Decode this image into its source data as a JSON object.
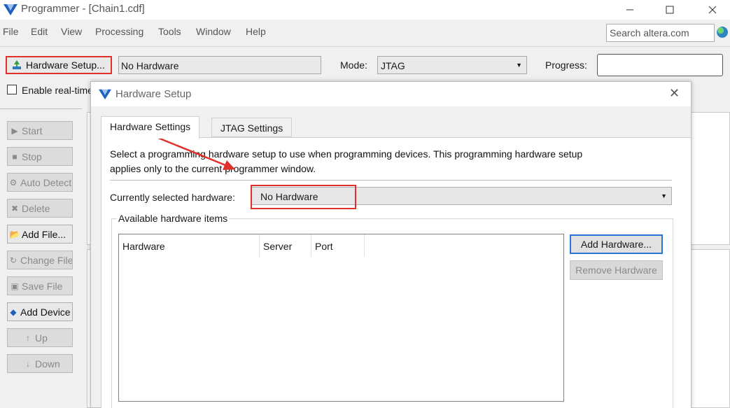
{
  "window": {
    "title": "Programmer - [Chain1.cdf]"
  },
  "menu": [
    "File",
    "Edit",
    "View",
    "Processing",
    "Tools",
    "Window",
    "Help"
  ],
  "search": {
    "placeholder": "Search altera.com"
  },
  "toolbar": {
    "hardware_setup_label": "Hardware Setup...",
    "hardware_value": "No Hardware",
    "mode_label": "Mode:",
    "mode_value": "JTAG",
    "progress_label": "Progress:",
    "realtime_label": "Enable real-time ISP to allow background programming"
  },
  "sidebar": {
    "buttons": [
      {
        "label": "Start",
        "enabled": false,
        "icon": "start-icon"
      },
      {
        "label": "Stop",
        "enabled": false,
        "icon": "stop-icon"
      },
      {
        "label": "Auto Detect",
        "enabled": false,
        "icon": "auto-detect-icon"
      },
      {
        "label": "Delete",
        "enabled": false,
        "icon": "delete-icon"
      },
      {
        "label": "Add File...",
        "enabled": true,
        "icon": "add-file-icon"
      },
      {
        "label": "Change File",
        "enabled": false,
        "icon": "change-file-icon"
      },
      {
        "label": "Save File",
        "enabled": false,
        "icon": "save-file-icon"
      },
      {
        "label": "Add Device",
        "enabled": true,
        "icon": "add-device-icon"
      },
      {
        "label": "Up",
        "enabled": false,
        "icon": "up-icon"
      },
      {
        "label": "Down",
        "enabled": false,
        "icon": "down-icon"
      }
    ]
  },
  "dialog": {
    "title": "Hardware Setup",
    "tabs": [
      "Hardware Settings",
      "JTAG Settings"
    ],
    "description": "Select a programming hardware setup to use when programming devices. This programming hardware setup applies only to the current programmer window.",
    "current_label": "Currently selected hardware:",
    "current_value": "No Hardware",
    "available_title": "Available hardware items",
    "table_columns": [
      "Hardware",
      "Server",
      "Port"
    ],
    "add_button": "Add Hardware...",
    "remove_button": "Remove Hardware"
  },
  "colors": {
    "highlight": "#e0302a",
    "focus_blue": "#2b74d4"
  }
}
